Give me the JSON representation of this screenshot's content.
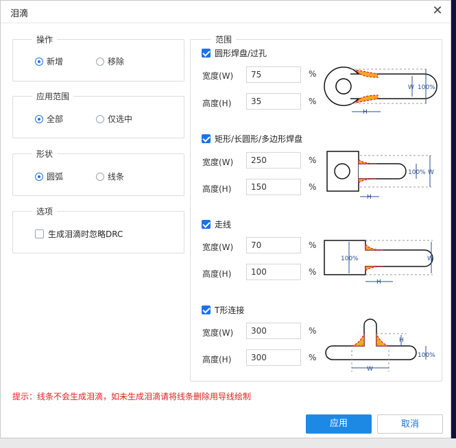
{
  "dialog": {
    "title": "泪滴"
  },
  "operation": {
    "legend": "操作",
    "opt_add": "新增",
    "opt_remove": "移除",
    "selected": "add"
  },
  "scope": {
    "legend": "应用范围",
    "opt_all": "全部",
    "opt_selected": "仅选中",
    "selected": "all"
  },
  "shape": {
    "legend": "形状",
    "opt_arc": "圆弧",
    "opt_line": "线条",
    "selected": "arc"
  },
  "options": {
    "legend": "选项",
    "ignore_drc_label": "生成泪滴时忽略DRC",
    "ignore_drc_checked": false
  },
  "range": {
    "legend": "范围",
    "width_label": "宽度(W)",
    "height_label": "高度(H)",
    "percent": "%",
    "groups": [
      {
        "label": "圆形焊盘/过孔",
        "checked": true,
        "width": "75",
        "height": "35"
      },
      {
        "label": "矩形/长圆形/多边形焊盘",
        "checked": true,
        "width": "250",
        "height": "150"
      },
      {
        "label": "走线",
        "checked": true,
        "width": "70",
        "height": "100"
      },
      {
        "label": "T形连接",
        "checked": true,
        "width": "300",
        "height": "300"
      }
    ]
  },
  "diagram_labels": {
    "w": "W",
    "h": "H",
    "pct100": "100%"
  },
  "hint": "提示：线条不会生成泪滴，如未生成泪滴请将线条删除用导线绘制",
  "buttons": {
    "ok": "应用",
    "cancel": "取消"
  },
  "colors": {
    "accent": "#1e88e5",
    "hint": "#e02020",
    "teardrop_fill": "#f5a623",
    "teardrop_edge": "#d0021b",
    "dim_blue": "#2a4d8f"
  }
}
